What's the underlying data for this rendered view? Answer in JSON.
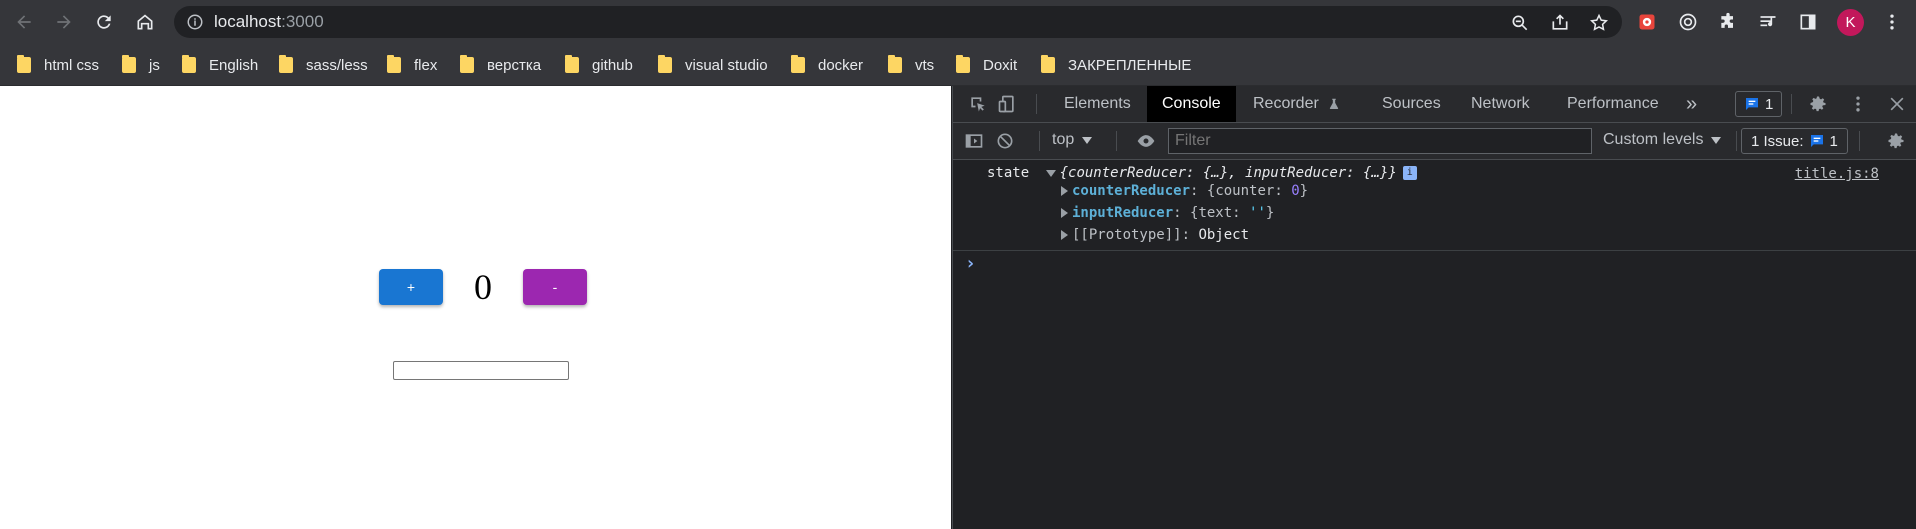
{
  "browser": {
    "url_host": "localhost",
    "url_port": ":3000",
    "profile_initial": "K"
  },
  "bookmarks": [
    {
      "label": "html css"
    },
    {
      "label": "js"
    },
    {
      "label": "English"
    },
    {
      "label": "sass/less"
    },
    {
      "label": "flex"
    },
    {
      "label": "верстка"
    },
    {
      "label": "github"
    },
    {
      "label": "visual studio"
    },
    {
      "label": "docker"
    },
    {
      "label": "vts"
    },
    {
      "label": "Doxit"
    },
    {
      "label": "ЗАКРЕПЛЕННЫЕ"
    }
  ],
  "app": {
    "plus_label": "+",
    "minus_label": "-",
    "counter_value": "0",
    "input_value": ""
  },
  "devtools": {
    "tabs": [
      "Elements",
      "Console",
      "Recorder",
      "Sources",
      "Network",
      "Performance"
    ],
    "active_tab": "Console",
    "more_tabs": "»",
    "messages_count": "1",
    "context": "top",
    "filter_placeholder": "Filter",
    "levels": "Custom levels",
    "issues_label": "1 Issue:",
    "issues_count": "1"
  },
  "console": {
    "label": "state",
    "summary": "{counterReducer: {…}, inputReducer: {…}}",
    "source": "title.js:8",
    "props": [
      {
        "key": "counterReducer",
        "open": "{",
        "inner_key": "counter",
        "sep": ": ",
        "value": "0",
        "close": "}"
      },
      {
        "key": "inputReducer",
        "open": "{",
        "inner_key": "text",
        "sep": ": ",
        "value": "''",
        "close": "}"
      },
      {
        "key": "[[Prototype]]",
        "value": "Object"
      }
    ],
    "prompt": "›"
  }
}
